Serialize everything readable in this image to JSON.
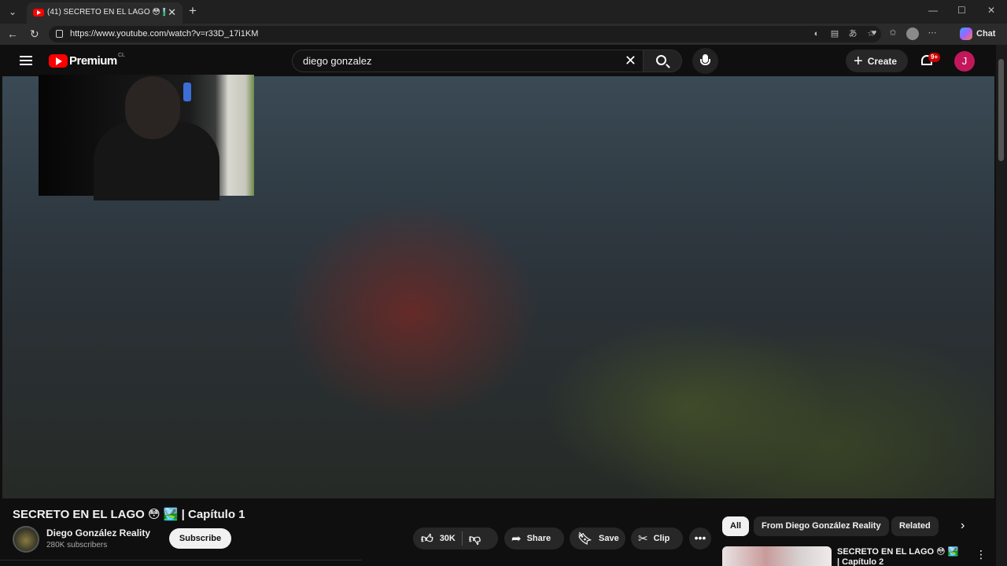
{
  "browser": {
    "tab_title": "(41) SECRETO EN EL LAGO 😳 🏞️ | Capítulo 1",
    "url": "https://www.youtube.com/watch?v=r33D_17i1KM",
    "copilot_label": "Chat"
  },
  "masthead": {
    "brand": "Premium",
    "country_code": "CL",
    "search_value": "diego gonzalez",
    "create_label": "Create",
    "notification_badge": "9+",
    "avatar_initial": "J"
  },
  "video": {
    "title": "SECRETO EN EL LAGO 😳 🏞️ | Capítulo 1",
    "channel_name": "Diego González Reality",
    "subscribers": "280K subscribers",
    "subscribe_label": "Subscribe",
    "like_count": "30K",
    "share_label": "Share",
    "save_label": "Save",
    "clip_label": "Clip"
  },
  "chips": [
    "All",
    "From Diego González Reality",
    "Related"
  ],
  "recommendation": {
    "title": "SECRETO EN EL LAGO 😳 🏞️ | Capítulo 2"
  }
}
